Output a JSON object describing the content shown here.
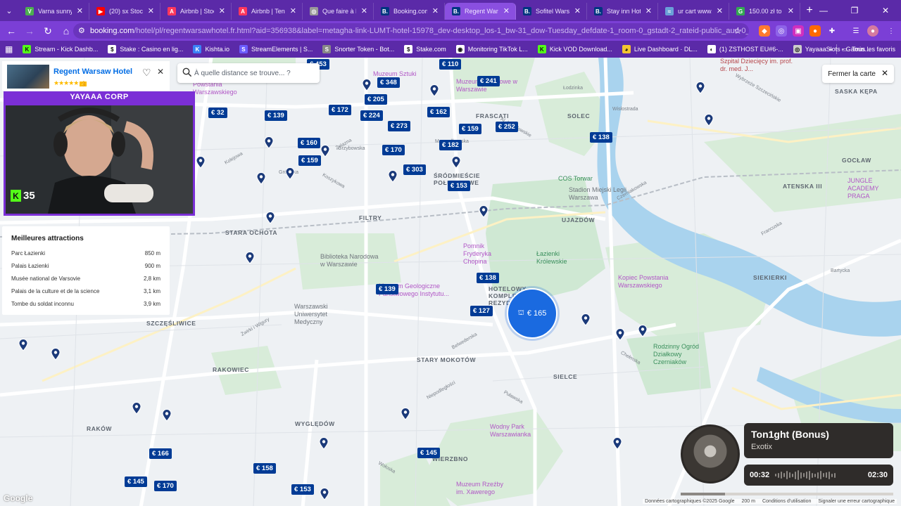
{
  "browser": {
    "tabs": [
      {
        "title": "Varna sunny be",
        "favicon": "V",
        "color": "#4caf50",
        "active": false
      },
      {
        "title": "(20) sx Stockho",
        "favicon": "▶",
        "color": "#ff0000",
        "active": false
      },
      {
        "title": "Airbnb | Stockh",
        "favicon": "A",
        "color": "#ff385c",
        "active": false
      },
      {
        "title": "Airbnb | Tener",
        "favicon": "A",
        "color": "#ff385c",
        "active": false
      },
      {
        "title": "Que faire à Pra",
        "favicon": "◎",
        "color": "#999999",
        "active": false
      },
      {
        "title": "Booking.com: H",
        "favicon": "B.",
        "color": "#003580",
        "active": false
      },
      {
        "title": "Regent Warsaw",
        "favicon": "B.",
        "color": "#003580",
        "active": true
      },
      {
        "title": "Sofitel Warsaw",
        "favicon": "B.",
        "color": "#003580",
        "active": false
      },
      {
        "title": "Stay inn Hotel",
        "favicon": "B.",
        "color": "#003580",
        "active": false
      },
      {
        "title": "ur cart www.pu",
        "favicon": "≈",
        "color": "#6aa0d8",
        "active": false
      },
      {
        "title": "150.00 zł to eu",
        "favicon": "G",
        "color": "#34a853",
        "active": false
      }
    ],
    "tab_nav_icon": "⌄",
    "new_tab": "+",
    "window_controls": [
      "—",
      "❐",
      "✕"
    ],
    "url_host": "booking.com",
    "url_path": "/hotel/pl/regentwarsawhotel.fr.html?aid=356938&label=metagha-link-LUMT-hotel-15978_dev-desktop_los-1_bw-31_dow-Tuesday_defdate-1_room-0_gstadt-2_rateid-public_aud-0_gacid-21404706195_mci...",
    "nav_icons": {
      "back": "←",
      "forward": "→",
      "reload": "↻",
      "home": "⌂"
    },
    "bookmarks": [
      {
        "label": "Stream - Kick Dashb...",
        "icon": "K",
        "color": "#53fc18",
        "text_color": "#111"
      },
      {
        "label": "Stake : Casino en lig...",
        "icon": "$",
        "color": "#ffffff",
        "text_color": "#111"
      },
      {
        "label": "Kishta.io",
        "icon": "K",
        "color": "#3b82f6",
        "text_color": "#fff"
      },
      {
        "label": "StreamElements | S...",
        "icon": "S",
        "color": "#6b5cff",
        "text_color": "#fff"
      },
      {
        "label": "Snorter Token - Bot...",
        "icon": "S",
        "color": "#888888",
        "text_color": "#fff"
      },
      {
        "label": "Stake.com",
        "icon": "$",
        "color": "#ffffff",
        "text_color": "#111"
      },
      {
        "label": "Monitoring TikTok L...",
        "icon": "◉",
        "color": "#ffffff",
        "text_color": "#111"
      },
      {
        "label": "Kick VOD Download...",
        "icon": "K",
        "color": "#53fc18",
        "text_color": "#111"
      },
      {
        "label": "Live Dashboard · DL...",
        "icon": "◕",
        "color": "#f4c430",
        "text_color": "#111"
      },
      {
        "label": "(1) ZSTHOST EU#6-...",
        "icon": "◐",
        "color": "#ffffff",
        "text_color": "#111"
      },
      {
        "label": "YayaaaSlots - Gamin...",
        "icon": "◎",
        "color": "#cccccc",
        "text_color": "#111"
      }
    ],
    "bookmarks_more": "»",
    "all_bookmarks": "Tous les favoris"
  },
  "map": {
    "search_placeholder": "À quelle distance se trouve... ?",
    "close_map": "Fermer la carte",
    "close_icon": "✕",
    "selected_price": "€ 165",
    "prices": [
      {
        "label": "€ 453"
      },
      {
        "label": "€ 348"
      },
      {
        "label": "€ 110"
      },
      {
        "label": "€ 241"
      },
      {
        "label": "€ 32"
      },
      {
        "label": "€ 139"
      },
      {
        "label": "€ 205"
      },
      {
        "label": "€ 172"
      },
      {
        "label": "€ 224"
      },
      {
        "label": "€ 162"
      },
      {
        "label": "€ 273"
      },
      {
        "label": "€ 159"
      },
      {
        "label": "€ 252"
      },
      {
        "label": "€ 138"
      },
      {
        "label": "€ 160"
      },
      {
        "label": "€ 170"
      },
      {
        "label": "€ 182"
      },
      {
        "label": "€ 159"
      },
      {
        "label": "€ 303"
      },
      {
        "label": "€ 153"
      },
      {
        "label": "€ 138"
      },
      {
        "label": "€ 139"
      },
      {
        "label": "€ 127"
      },
      {
        "label": "€ 166"
      },
      {
        "label": "€ 145"
      },
      {
        "label": "€ 158"
      },
      {
        "label": "€ 145"
      },
      {
        "label": "€ 170"
      },
      {
        "label": "€ 153"
      }
    ],
    "districts": [
      {
        "label": "FRASCATI"
      },
      {
        "label": "SOLEC"
      },
      {
        "label": "SASKA KĘPA"
      },
      {
        "label": "ŚRÓDMIEŚCIE POŁUDNIOWE"
      },
      {
        "label": "FILTRY"
      },
      {
        "label": "UJAZDÓW"
      },
      {
        "label": "STARA OCHOTA"
      },
      {
        "label": "GOCŁAW"
      },
      {
        "label": "ATENSKA III"
      },
      {
        "label": "SIEKIERKI"
      },
      {
        "label": "SZCZĘŚLIWICE"
      },
      {
        "label": "RAKOWIEC"
      },
      {
        "label": "STARY MOKOTÓW"
      },
      {
        "label": "SIELCE"
      },
      {
        "label": "RAKÓW"
      },
      {
        "label": "WYGLĘDÓW"
      },
      {
        "label": "WIERZBNO"
      },
      {
        "label": "HOTELOWY KOMPLEKS REZYDENCYJNY"
      }
    ],
    "pois": [
      {
        "label": "Muzeum Sztuki",
        "kind": "museum"
      },
      {
        "label": "Muzeum Narodowe w Warszawie",
        "kind": "museum"
      },
      {
        "label": "Szpital Dziecięcy im. prof. dr. med. J...",
        "kind": "hospital"
      },
      {
        "label": "COS Torwar",
        "kind": "park"
      },
      {
        "label": "Stadion Miejski Legii Warszawa",
        "kind": "venue"
      },
      {
        "label": "JUNGLE ACADEMY PRAGA",
        "kind": "museum"
      },
      {
        "label": "Pomnik Fryderyka Chopina",
        "kind": "museum"
      },
      {
        "label": "Łazienki Królewskie",
        "kind": "park"
      },
      {
        "label": "Biblioteka Narodowa w Warszawie",
        "kind": "venue"
      },
      {
        "label": "Muzeum Geologiczne Państwowego Instytutu...",
        "kind": "museum"
      },
      {
        "label": "Warszawski Uniwersytet Medyczny",
        "kind": "venue"
      },
      {
        "label": "Kopiec Powstania Warszawskiego",
        "kind": "museum"
      },
      {
        "label": "Rodzinny Ogród Działkowy Czerniaków",
        "kind": "park"
      },
      {
        "label": "Wodny Park Warszawianka",
        "kind": "museum"
      },
      {
        "label": "Muzeum Rzeźby im. Xawerego",
        "kind": "museum"
      },
      {
        "label": "Muzeum Powstania Warszawskiego",
        "kind": "museum"
      }
    ],
    "streets": [
      "Kolejowa",
      "Grójecka",
      "Koszykowa",
      "Żelazna",
      "Marszałkowska",
      "Al. Ujazdowskie",
      "Czerniakowska",
      "Wisłostrada",
      "Puławska",
      "Niepodległości",
      "Grzybowska",
      "Wołoska",
      "Żwirki i Wigury",
      "Łodzinka",
      "Wybrzeże Szczecińskie",
      "Francuska",
      "Bartycka",
      "Chełmska",
      "Belwederska"
    ],
    "footer": [
      "Données cartographiques ©2025 Google",
      "200 m",
      "Conditions d'utilisation",
      "Signaler une erreur cartographique"
    ],
    "google_logo": "Google"
  },
  "hotel_card": {
    "name": "Regent Warsaw Hotel",
    "stars": "★★★★★",
    "badge": "👍"
  },
  "stream": {
    "channel": "YAYAAA CORP",
    "viewer_count": "35",
    "kick_icon": "K"
  },
  "attractions": {
    "title": "Meilleures attractions",
    "items": [
      {
        "name": "Parc Łazienki",
        "distance": "850 m"
      },
      {
        "name": "Palais Łazienki",
        "distance": "900 m"
      },
      {
        "name": "Musée national de Varsovie",
        "distance": "2,8 km"
      },
      {
        "name": "Palais de la culture et de la science",
        "distance": "3,1 km"
      },
      {
        "name": "Tombe du soldat inconnu",
        "distance": "3,9 km"
      }
    ]
  },
  "music": {
    "title": "Ton1ght (Bonus)",
    "artist": "Exotix",
    "elapsed": "00:32",
    "duration": "02:30",
    "progress": 0.21
  },
  "colors": {
    "brand_purple": "#5b2aa8",
    "booking_blue": "#003b95",
    "selected_blue": "#1a6ae0"
  }
}
